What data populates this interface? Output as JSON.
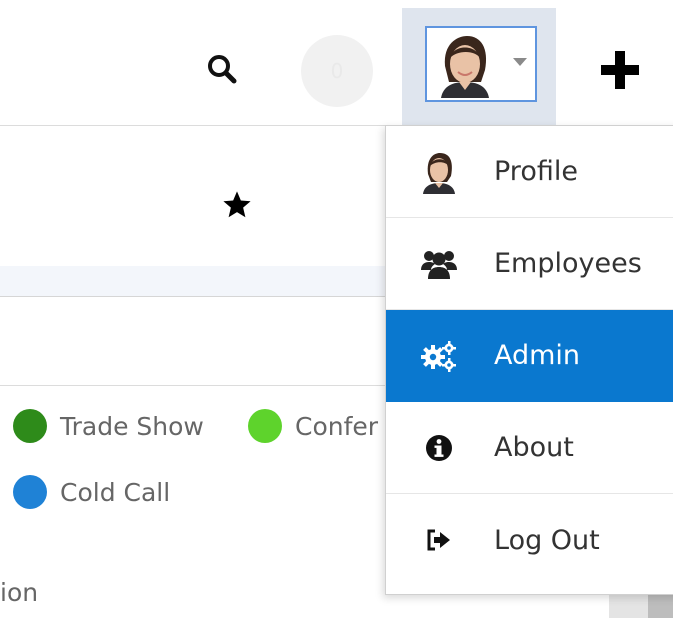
{
  "header": {
    "search_icon": "search-icon",
    "notification_count": "0",
    "avatar_icon": "user-avatar",
    "add_icon": "plus-icon"
  },
  "toolbar": {
    "favorite_icon": "star-icon"
  },
  "legend": {
    "items": [
      {
        "label": "Trade Show",
        "color": "#2e8b1a"
      },
      {
        "label": "Confer",
        "color": "#5ed32c"
      },
      {
        "label": "Cold Call",
        "color": "#1f82d6"
      }
    ]
  },
  "partial_text": "ion",
  "user_menu": {
    "items": [
      {
        "label": "Profile",
        "icon": "user-avatar"
      },
      {
        "label": "Employees",
        "icon": "users-icon"
      },
      {
        "label": "Admin",
        "icon": "gears-icon",
        "active": true
      },
      {
        "label": "About",
        "icon": "info-circle-icon"
      },
      {
        "label": "Log Out",
        "icon": "sign-out-icon"
      }
    ]
  },
  "colors": {
    "active_item": "#0a78cf",
    "avatar_border": "#5f95df",
    "avatar_tab_bg": "#dfe5ee"
  }
}
